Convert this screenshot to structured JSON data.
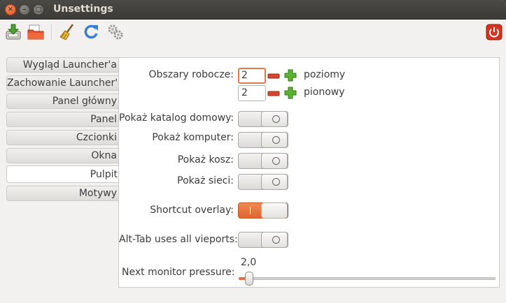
{
  "window": {
    "title": "Unsettings"
  },
  "titlebar_buttons": {
    "close": "×",
    "minimize": "–",
    "maximize": "□"
  },
  "toolbar": {
    "icons": [
      "install-icon",
      "open-folder-icon",
      "clean-broom-icon",
      "refresh-icon",
      "settings-gears-icon",
      "power-icon"
    ]
  },
  "sidebar": {
    "items": [
      {
        "label": "Wygląd Launcher'a"
      },
      {
        "label": "Zachowanie Launcher'a"
      },
      {
        "label": "Panel główny"
      },
      {
        "label": "Panel"
      },
      {
        "label": "Czcionki"
      },
      {
        "label": "Okna"
      },
      {
        "label": "Pulpit",
        "active": true
      },
      {
        "label": "Motywy"
      }
    ]
  },
  "desktop": {
    "workspaces_label": "Obszary robocze:",
    "horizontal": {
      "value": "2",
      "unit": "poziomy"
    },
    "vertical": {
      "value": "2",
      "unit": "pionowy"
    },
    "show_home_label": "Pokaż katalog domowy:",
    "show_computer_label": "Pokaż komputer:",
    "show_trash_label": "Pokaż kosz:",
    "show_network_label": "Pokaż sieci:",
    "shortcut_overlay_label": "Shortcut overlay:",
    "alt_tab_label": "Alt-Tab uses all vieports:",
    "monitor_pressure_label": "Next monitor pressure:",
    "monitor_pressure_value": "2,0",
    "monitor_pressure_fraction": 0.03,
    "switches": {
      "show_home": false,
      "show_computer": false,
      "show_trash": false,
      "show_network": false,
      "shortcut_overlay": true,
      "alt_tab": false
    }
  },
  "colors": {
    "accent": "#e96f38",
    "titlebar": "#3c3b37"
  }
}
